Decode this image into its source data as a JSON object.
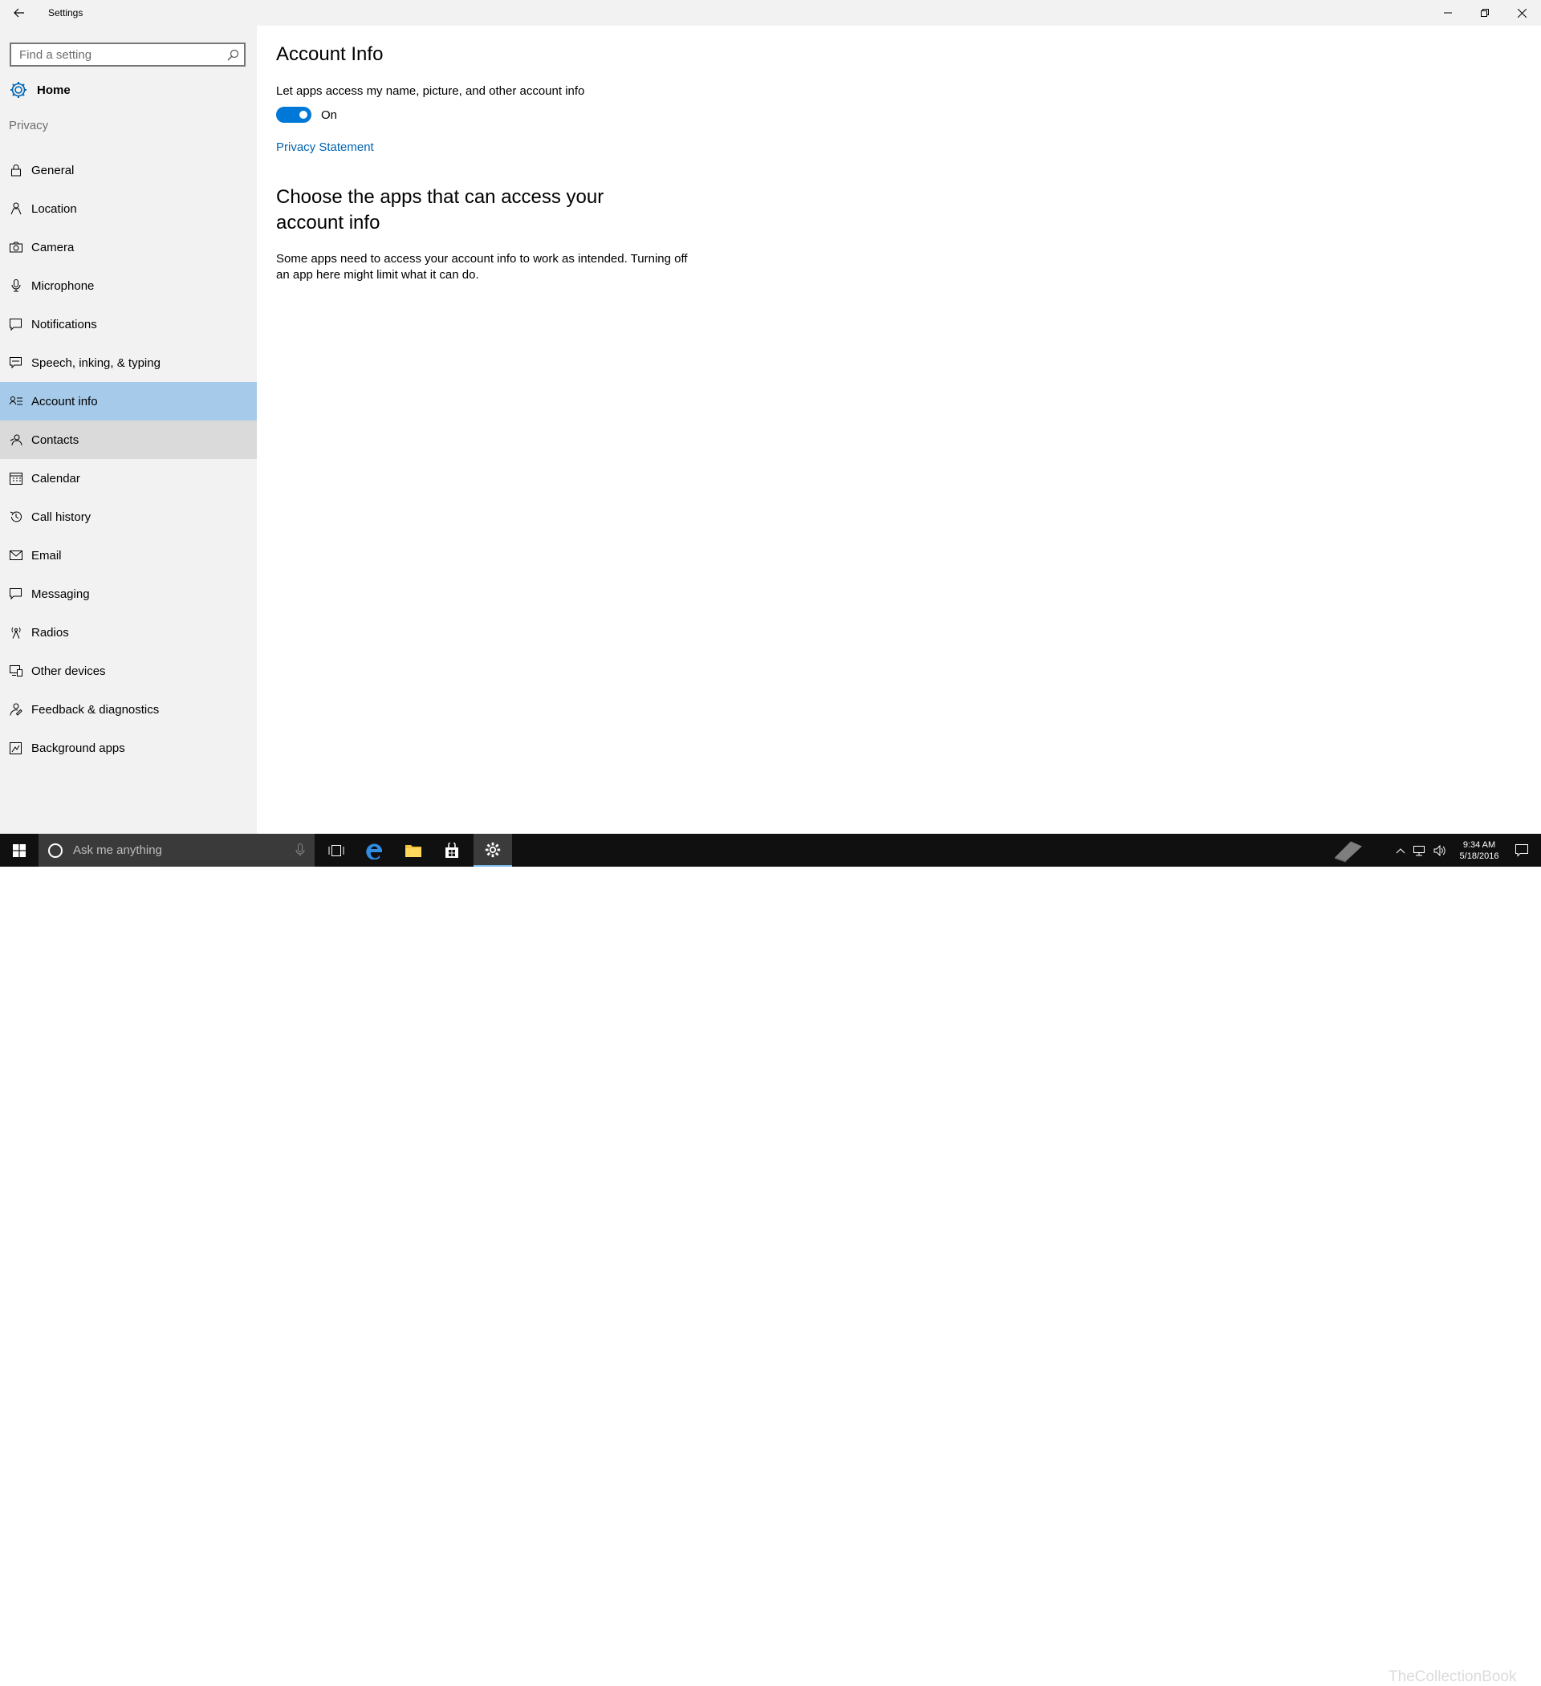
{
  "window": {
    "title": "Settings"
  },
  "sidebar": {
    "search_placeholder": "Find a setting",
    "home_label": "Home",
    "section_label": "Privacy",
    "items": [
      {
        "label": "General",
        "icon": "lock-icon"
      },
      {
        "label": "Location",
        "icon": "location-person-icon"
      },
      {
        "label": "Camera",
        "icon": "camera-icon"
      },
      {
        "label": "Microphone",
        "icon": "microphone-icon"
      },
      {
        "label": "Notifications",
        "icon": "notification-icon"
      },
      {
        "label": "Speech, inking, & typing",
        "icon": "speech-icon"
      },
      {
        "label": "Account info",
        "icon": "account-info-icon",
        "selected": true
      },
      {
        "label": "Contacts",
        "icon": "contacts-icon",
        "hover": true
      },
      {
        "label": "Calendar",
        "icon": "calendar-icon"
      },
      {
        "label": "Call history",
        "icon": "history-icon"
      },
      {
        "label": "Email",
        "icon": "mail-icon"
      },
      {
        "label": "Messaging",
        "icon": "message-icon"
      },
      {
        "label": "Radios",
        "icon": "radio-tower-icon"
      },
      {
        "label": "Other devices",
        "icon": "devices-icon"
      },
      {
        "label": "Feedback & diagnostics",
        "icon": "feedback-icon"
      },
      {
        "label": "Background apps",
        "icon": "background-apps-icon"
      }
    ]
  },
  "main": {
    "title": "Account Info",
    "toggle_description": "Let apps access my name, picture, and other account info",
    "toggle_state": "On",
    "privacy_link": "Privacy Statement",
    "apps_heading": "Choose the apps that can access your account info",
    "apps_description": "Some apps need to access your account info to work as intended. Turning off an app here might limit what it can do."
  },
  "taskbar": {
    "search_placeholder": "Ask me anything",
    "time": "9:34 AM",
    "date": "5/18/2016",
    "watermark": "TheCollectionBook"
  },
  "colors": {
    "accent": "#0078d7",
    "selected_bg": "#a6cbea",
    "link": "#0063b1",
    "sidebar_bg": "#f2f2f2",
    "taskbar_bg": "#101010"
  }
}
